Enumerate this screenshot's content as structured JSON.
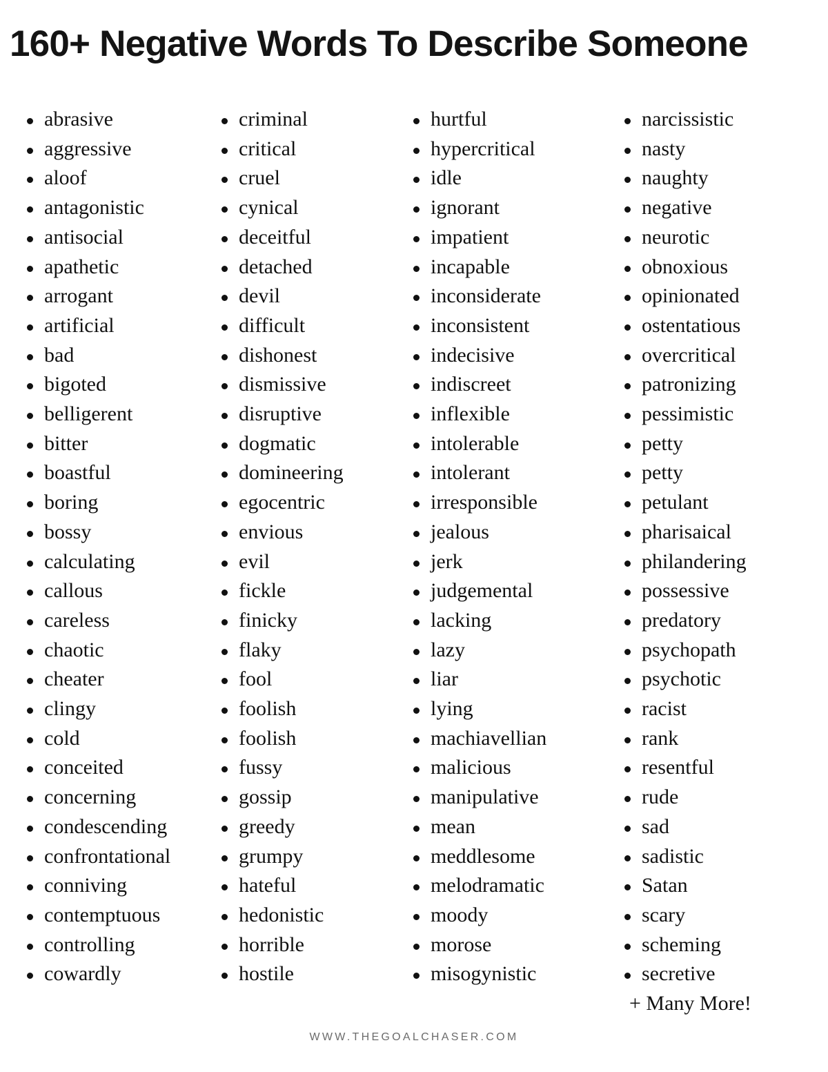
{
  "header": {
    "title": "160+ Negative Words To Describe Someone"
  },
  "footer": {
    "site_url": "WWW.THEGOALCHASER.COM"
  },
  "list": {
    "extra_line": "+ Many More!",
    "columns": [
      {
        "id": "column-1",
        "items": [
          "abrasive",
          "aggressive",
          "aloof",
          "antagonistic",
          "antisocial",
          "apathetic",
          "arrogant",
          "artificial",
          "bad",
          "bigoted",
          "belligerent",
          "bitter",
          "boastful",
          "boring",
          "bossy",
          "calculating",
          "callous",
          "careless",
          "chaotic",
          "cheater",
          "clingy",
          "cold",
          "conceited",
          "concerning",
          "condescending",
          "confrontational",
          "conniving",
          "contemptuous",
          "controlling",
          "cowardly"
        ]
      },
      {
        "id": "column-2",
        "items": [
          "criminal",
          "critical",
          "cruel",
          "cynical",
          "deceitful",
          "detached",
          "devil",
          "difficult",
          "dishonest",
          "dismissive",
          "disruptive",
          "dogmatic",
          "domineering",
          "egocentric",
          "envious",
          "evil",
          "fickle",
          "finicky",
          "flaky",
          "fool",
          "foolish",
          "foolish",
          "fussy",
          "gossip",
          "greedy",
          "grumpy",
          "hateful",
          "hedonistic",
          "horrible",
          "hostile"
        ]
      },
      {
        "id": "column-3",
        "items": [
          "hurtful",
          "hypercritical",
          "idle",
          "ignorant",
          "impatient",
          "incapable",
          "inconsiderate",
          "inconsistent",
          "indecisive",
          "indiscreet",
          "inflexible",
          "intolerable",
          "intolerant",
          "irresponsible",
          "jealous",
          "jerk",
          "judgemental",
          "lacking",
          "lazy",
          "liar",
          "lying",
          "machiavellian",
          "malicious",
          "manipulative",
          "mean",
          "meddlesome",
          "melodramatic",
          "moody",
          "morose",
          "misogynistic"
        ]
      },
      {
        "id": "column-4",
        "items": [
          "narcissistic",
          "nasty",
          "naughty",
          "negative",
          "neurotic",
          "obnoxious",
          "opinionated",
          "ostentatious",
          "overcritical",
          "patronizing",
          "pessimistic",
          "petty",
          "petty",
          "petulant",
          "pharisaical",
          "philandering",
          "possessive",
          "predatory",
          "psychopath",
          "psychotic",
          "racist",
          "rank",
          "resentful",
          "rude",
          "sad",
          "sadistic",
          "Satan",
          "scary",
          "scheming",
          "secretive"
        ]
      }
    ]
  },
  "colors": {
    "background": "#ffffff",
    "text": "#111111",
    "title": "#141414",
    "footer_text": "#6b6b6b"
  }
}
